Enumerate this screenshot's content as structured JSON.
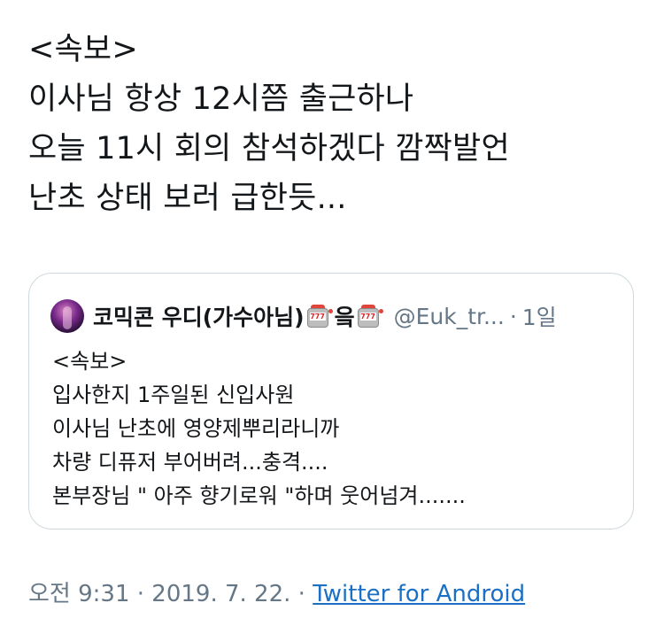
{
  "tweet": {
    "lines": [
      "<속보>",
      "이사님 항상 12시쯤 출근하나",
      "오늘 11시 회의 참석하겠다 깜짝발언",
      "난초 상태 보러 급한듯..."
    ]
  },
  "quote": {
    "avatar_icon": "user-avatar",
    "name_part1": "코믹콘 우디(가수아님)",
    "emoji1": "slot-machine-emoji",
    "name_part2": "읔",
    "emoji2": "slot-machine-emoji",
    "slot_label": "777",
    "handle": "@Euk_tr...",
    "separator": "·",
    "time": "1일",
    "lines": [
      "<속보>",
      "입사한지 1주일된 신입사원",
      "이사님 난초에 영양제뿌리라니까",
      "차량 디퓨저 부어버려...충격....",
      "본부장님 \" 아주 향기로워 \"하며 웃어넘겨......."
    ]
  },
  "meta": {
    "timestamp": "오전 9:31 · 2019. 7. 22. · ",
    "via": "Twitter for Android",
    "link_color": "#1b6fc4"
  }
}
